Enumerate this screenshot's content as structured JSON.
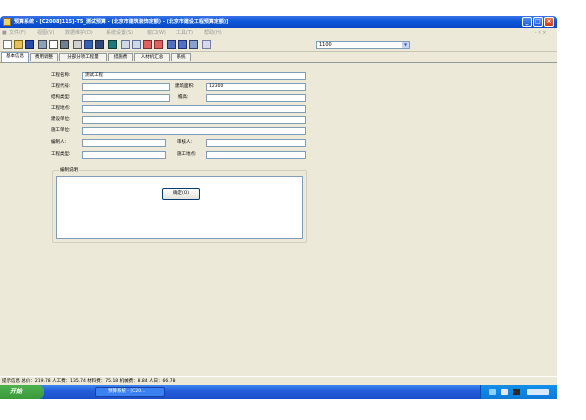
{
  "window": {
    "title": "预算系统 - [C2008]115]-T5_测试预算 - (北京市建筑装饰定额) - (北京市建设工程预算定额)]",
    "controls": {
      "minimize": "_",
      "maximize": "□",
      "close": "×"
    }
  },
  "menu": {
    "items": [
      "文件(F)",
      "视图(V)",
      "数据维护(D)",
      "系统设置(S)",
      "窗口(W)",
      "工具(T)",
      "帮助(H)"
    ],
    "right": "- ♯ ×"
  },
  "toolbar": {
    "combo_value": "1100"
  },
  "tabs": {
    "items": [
      "基本信息",
      "费用调整",
      "分部分项工程量",
      "措施费",
      "人材机汇总",
      "系统"
    ],
    "active": 0
  },
  "form": {
    "project_name_label": "工程名称:",
    "project_name_value": "测试工程",
    "project_code_label": "工程代号:",
    "project_code_value": "",
    "building_area_label": "建筑面积:",
    "building_area_value": "12300",
    "structure_label": "结构类型:",
    "structure_value": "",
    "floors_label": "檐高:",
    "floors_value": "",
    "location_label": "工程地点:",
    "location_value": "",
    "build_unit_label": "建设单位:",
    "build_unit_value": "",
    "construct_unit_label": "施工单位:",
    "construct_unit_value": "",
    "compiler_label": "编制人:",
    "compiler_value": "",
    "reviewer_label": "审核人:",
    "reviewer_value": "",
    "project_type_label": "工程类型:",
    "project_type_value": "",
    "site_label": "施工地点:",
    "site_value": "",
    "notes_title": "编制说明",
    "ok_button": "确定(O)"
  },
  "status": {
    "text": "提示信息 总价：219.78 人工费：135.74 材料费：75.18 机械费：8.84 人日：66.78"
  },
  "taskbar": {
    "start": "开始",
    "task_label": "预算系统 - [C20..."
  },
  "colors": {
    "title_blue": "#0a56d8",
    "face": "#ece9d8",
    "field_border": "#7f9db9"
  }
}
